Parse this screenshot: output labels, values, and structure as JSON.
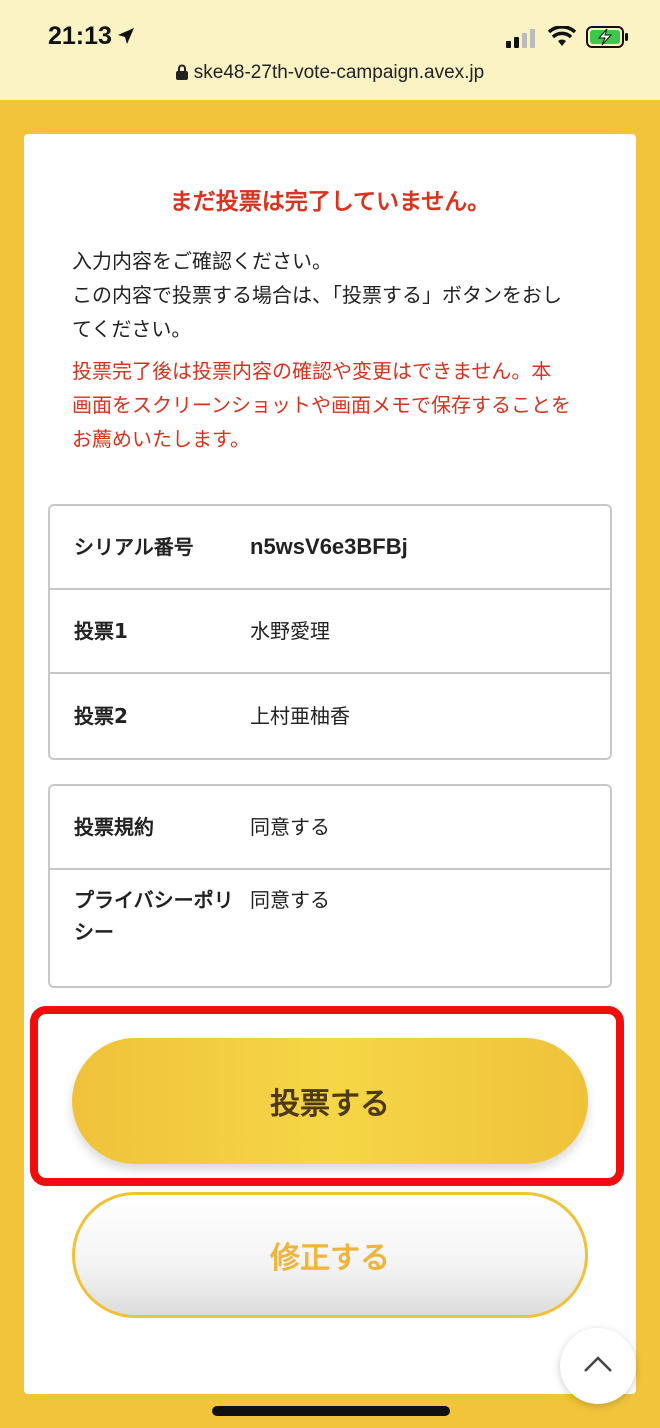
{
  "status_bar": {
    "time": "21:13",
    "icons": [
      "location-arrow-icon",
      "signal-icon",
      "wifi-icon",
      "battery-charging-icon"
    ]
  },
  "browser": {
    "url": "ske48-27th-vote-campaign.avex.jp"
  },
  "card": {
    "warning_title": "まだ投票は完了していません。",
    "intro_lines": [
      "入力内容をご確認ください。",
      "この内容で投票する場合は、「投票する」ボタンをおし",
      "てください。"
    ],
    "notice_lines": [
      "投票完了後は投票内容の確認や変更はできません。本",
      "画面をスクリーンショットや画面メモで保存することを",
      "お薦めいたします。"
    ]
  },
  "vote_table": {
    "rows": [
      {
        "key": "シリアル番号",
        "value": "n5wsV6e3BFBj"
      },
      {
        "key": "投票1",
        "value": "水野愛理"
      },
      {
        "key": "投票2",
        "value": "上村亜柚香"
      }
    ]
  },
  "agreement_table": {
    "rows": [
      {
        "key": "投票規約",
        "value": "同意する"
      },
      {
        "key_line1": "プライバシーポリ",
        "key_line2": "シー",
        "value": "同意する"
      }
    ]
  },
  "buttons": {
    "vote_label": "投票する",
    "edit_label": "修正する"
  },
  "colors": {
    "background_yellow": "#f2c43a",
    "warning_red": "#d9321e",
    "highlight_red": "#f00d0d",
    "button_text_brown": "#4d3a10"
  }
}
